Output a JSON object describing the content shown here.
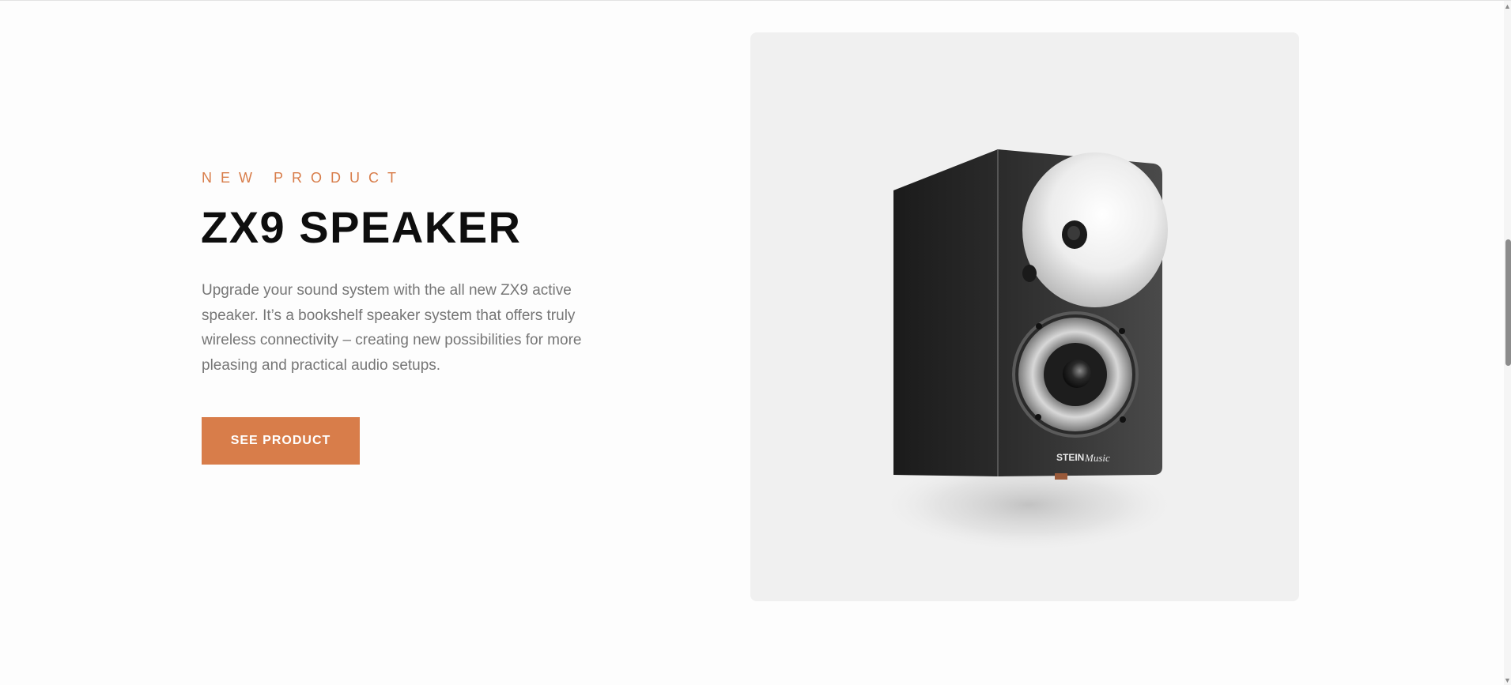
{
  "hero": {
    "eyebrow": "NEW PRODUCT",
    "title": "ZX9 SPEAKER",
    "description": "Upgrade your sound system with the all new ZX9 active speaker. It’s a bookshelf speaker system that offers truly wireless connectivity – creating new possibilities for more pleasing and practical audio setups.",
    "cta_label": "SEE PRODUCT"
  },
  "product_image": {
    "alt": "ZX9 speaker",
    "brand_text": "STEIN",
    "brand_script": "Music"
  },
  "colors": {
    "accent": "#d87d4a",
    "card_background": "#f0f0f0",
    "title": "#0e0e0e",
    "body_text": "#767676"
  },
  "scrollbar": {
    "up_arrow": "triangle-up-icon",
    "down_arrow": "triangle-down-icon"
  }
}
